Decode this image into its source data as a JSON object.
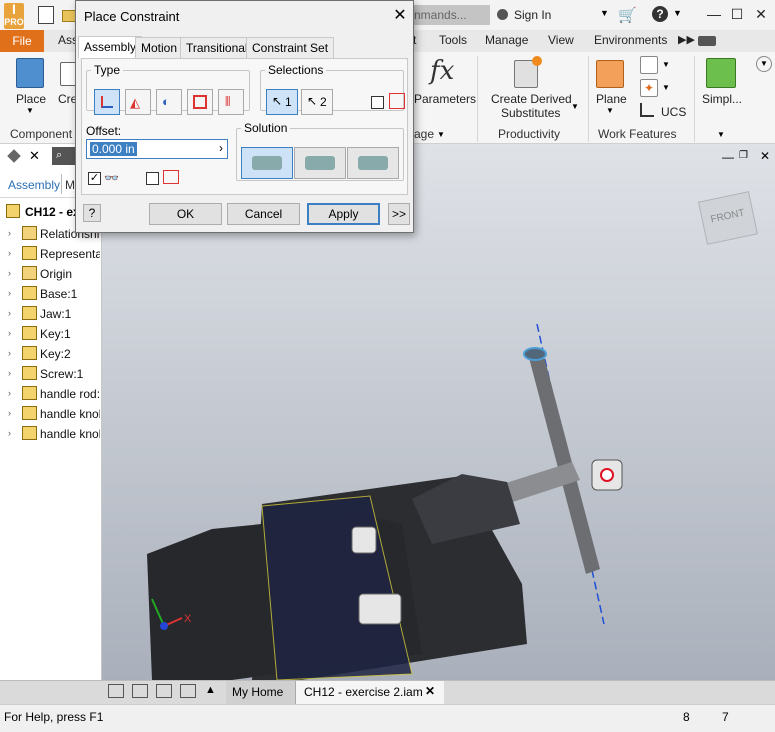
{
  "titlebar": {
    "logo_text": "PRO",
    "search_placeholder": "nmands...",
    "signin": "Sign In",
    "help_icon": "?"
  },
  "ribbon_tabs": {
    "file": "File",
    "assemble_partial": "Ass",
    "t": "t",
    "tools": "Tools",
    "manage": "Manage",
    "view": "View",
    "environments": "Environments"
  },
  "ribbon": {
    "place": "Place",
    "create_partial": "Cre",
    "component_group": "Component",
    "parameters": "Parameters",
    "create_derived": "Create Derived",
    "substitutes": "Substitutes",
    "productivity": "Productivity",
    "plane": "Plane",
    "ucs": "UCS",
    "work_features": "Work Features",
    "simplify": "Simpl...",
    "age_partial": "age"
  },
  "browser": {
    "tab_assembly": "Assembly",
    "tab_model_partial": "Mo",
    "root": "CH12 - ex",
    "items": [
      {
        "label": "Relationship",
        "icon": "folder-icon"
      },
      {
        "label": "Representati",
        "icon": "representations-icon"
      },
      {
        "label": "Origin",
        "icon": "folder-icon"
      },
      {
        "label": "Base:1",
        "icon": "grounded-part-icon"
      },
      {
        "label": "Jaw:1",
        "icon": "part-icon"
      },
      {
        "label": "Key:1",
        "icon": "part-icon"
      },
      {
        "label": "Key:2",
        "icon": "part-icon"
      },
      {
        "label": "Screw:1",
        "icon": "grounded-part-icon"
      },
      {
        "label": "handle rod:",
        "icon": "part-icon"
      },
      {
        "label": "handle knob",
        "icon": "part-icon"
      },
      {
        "label": "handle knob",
        "icon": "part-icon"
      }
    ]
  },
  "dialog": {
    "title": "Place Constraint",
    "tabs": [
      "Assembly",
      "Motion",
      "Transitional",
      "Constraint Set"
    ],
    "type_label": "Type",
    "selections_label": "Selections",
    "sel1": "1",
    "sel2": "2",
    "offset_label": "Offset:",
    "offset_value": "0.000 in",
    "solution_label": "Solution",
    "ok": "OK",
    "cancel": "Cancel",
    "apply": "Apply",
    "more": ">>",
    "help": "?"
  },
  "viewcube": {
    "label": "FRONT"
  },
  "doc_tabs": {
    "home": "My Home",
    "active_doc": "CH12 - exercise 2.iam"
  },
  "status": {
    "help_text": "For Help, press F1",
    "num1": "8",
    "num2": "7"
  },
  "colors": {
    "file_tab": "#e0701a",
    "accent_blue": "#3c7fc2",
    "viewport_top": "#dfe2e7",
    "viewport_bottom": "#aab0bb"
  }
}
